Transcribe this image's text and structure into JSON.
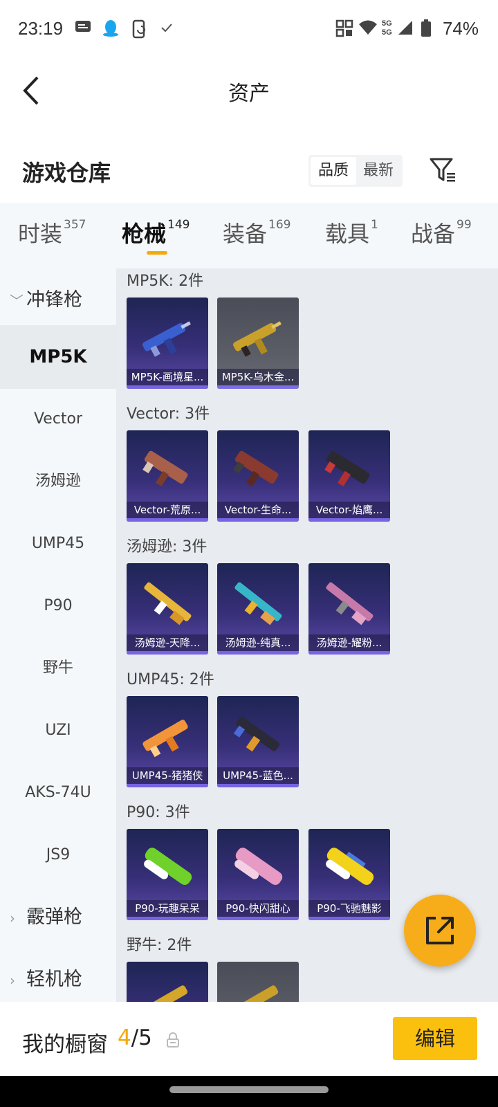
{
  "status_bar": {
    "time": "23:19",
    "network": "5G",
    "battery": "74%",
    "icons": [
      "message-icon",
      "qq-penguin-icon",
      "phone-sync-icon",
      "check-icon",
      "nfc-icon",
      "wifi-icon",
      "signal-icon",
      "battery-icon"
    ]
  },
  "header": {
    "title": "资产"
  },
  "warehouse": {
    "title": "游戏仓库",
    "sort_options": [
      "品质",
      "最新"
    ],
    "selected_sort": "品质"
  },
  "tabs": [
    {
      "label": "时装",
      "count": "357"
    },
    {
      "label": "枪械",
      "count": "149",
      "active": true
    },
    {
      "label": "装备",
      "count": "169"
    },
    {
      "label": "载具",
      "count": "1"
    },
    {
      "label": "战备",
      "count": "99"
    }
  ],
  "sidebar": {
    "group_open": "冲锋枪",
    "items": [
      "MP5K",
      "Vector",
      "汤姆逊",
      "UMP45",
      "P90",
      "野牛",
      "UZI",
      "AKS-74U",
      "JS9"
    ],
    "selected": "MP5K",
    "group_shotgun": "霰弹枪",
    "group_lmg": "轻机枪"
  },
  "sections": [
    {
      "title": "MP5K: 2件",
      "items": [
        "MP5K-画境星...",
        "MP5K-乌木金..."
      ]
    },
    {
      "title": "Vector: 3件",
      "items": [
        "Vector-荒原...",
        "Vector-生命...",
        "Vector-焰鹰..."
      ]
    },
    {
      "title": "汤姆逊: 3件",
      "items": [
        "汤姆逊-天降...",
        "汤姆逊-纯真...",
        "汤姆逊-耀粉..."
      ]
    },
    {
      "title": "UMP45: 2件",
      "items": [
        "UMP45-猪猪侠",
        "UMP45-蓝色..."
      ]
    },
    {
      "title": "P90: 3件",
      "items": [
        "P90-玩趣呆呆",
        "P90-快闪甜心",
        "P90-飞驰魅影"
      ]
    },
    {
      "title": "野牛: 2件",
      "items": [
        "",
        ""
      ]
    }
  ],
  "showcase": {
    "label": "我的橱窗",
    "current": "4",
    "total": "/5"
  },
  "buttons": {
    "edit": "编辑"
  },
  "colors": {
    "accent": "#f5a90a",
    "edit_button": "#fbbf0e",
    "card_top": "#1e2554",
    "card_bottom": "#5b4aa9"
  }
}
